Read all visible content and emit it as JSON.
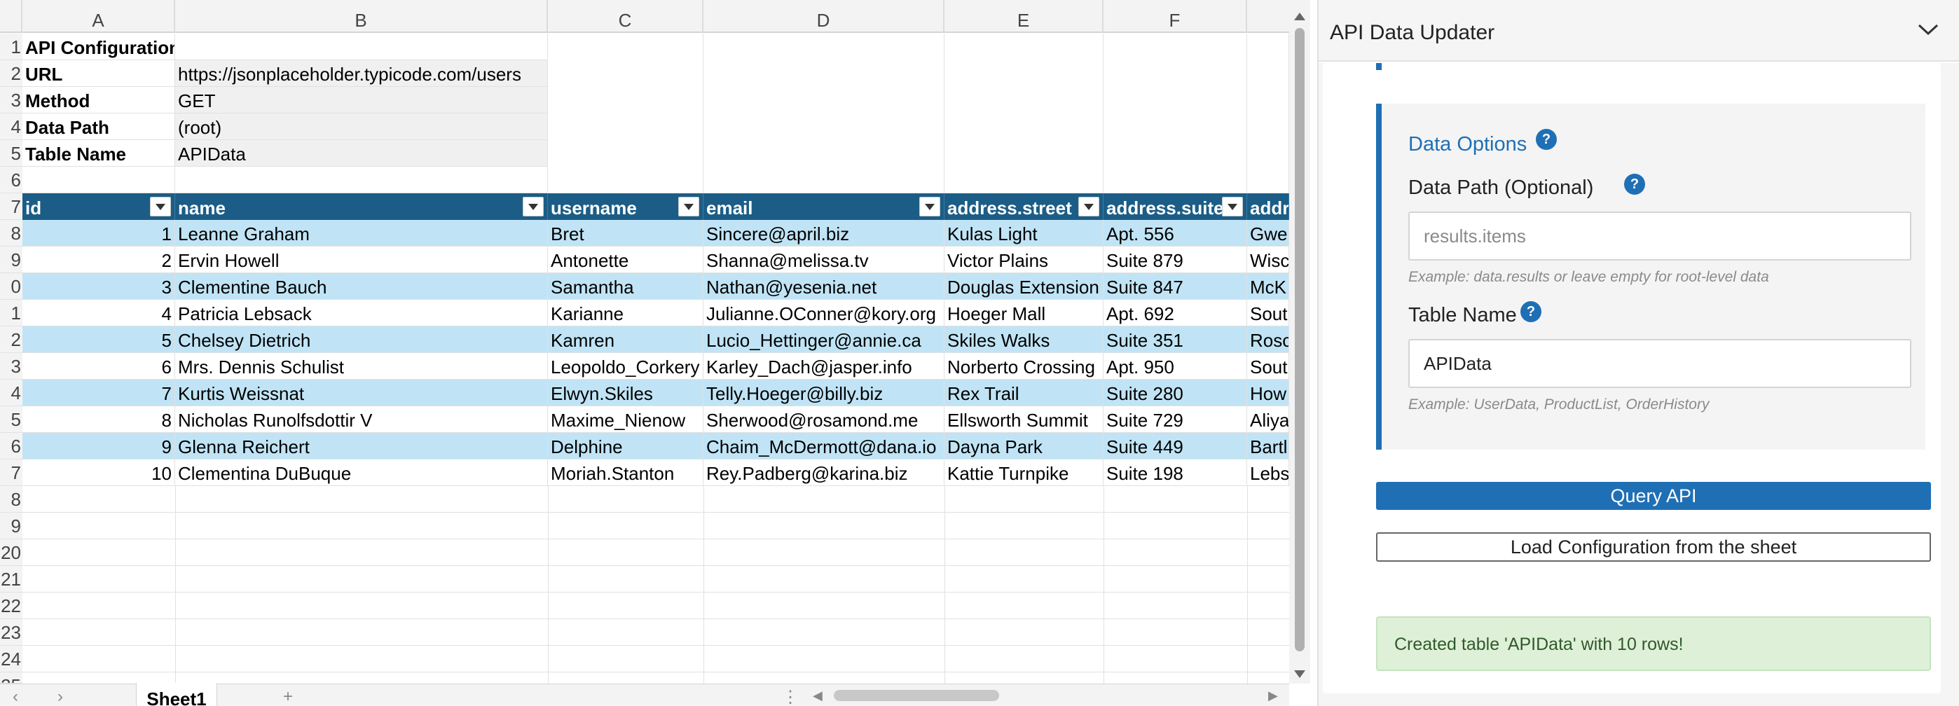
{
  "sheet": {
    "columns": [
      "A",
      "B",
      "C",
      "D",
      "E",
      "F"
    ],
    "rows": [
      "1",
      "2",
      "3",
      "4",
      "5",
      "6",
      "7",
      "8",
      "9",
      "0",
      "1",
      "2",
      "3",
      "4",
      "5",
      "6",
      "7",
      "8",
      "9",
      "20",
      "21",
      "22",
      "23",
      "24",
      "25"
    ],
    "config": [
      {
        "label": "API Configuration",
        "value": ""
      },
      {
        "label": "URL",
        "value": "https://jsonplaceholder.typicode.com/users"
      },
      {
        "label": "Method",
        "value": "GET"
      },
      {
        "label": "Data Path",
        "value": "(root)"
      },
      {
        "label": "Table Name",
        "value": "APIData"
      }
    ],
    "table_headers": [
      "id",
      "name",
      "username",
      "email",
      "address.street",
      "address.suite",
      "addr"
    ],
    "table_rows": [
      [
        "1",
        "Leanne Graham",
        "Bret",
        "Sincere@april.biz",
        "Kulas Light",
        "Apt. 556",
        "Gwe"
      ],
      [
        "2",
        "Ervin Howell",
        "Antonette",
        "Shanna@melissa.tv",
        "Victor Plains",
        "Suite 879",
        "Wisc"
      ],
      [
        "3",
        "Clementine Bauch",
        "Samantha",
        "Nathan@yesenia.net",
        "Douglas Extension",
        "Suite 847",
        "McK"
      ],
      [
        "4",
        "Patricia Lebsack",
        "Karianne",
        "Julianne.OConner@kory.org",
        "Hoeger Mall",
        "Apt. 692",
        "Sout"
      ],
      [
        "5",
        "Chelsey Dietrich",
        "Kamren",
        "Lucio_Hettinger@annie.ca",
        "Skiles Walks",
        "Suite 351",
        "Rosc"
      ],
      [
        "6",
        "Mrs. Dennis Schulist",
        "Leopoldo_Corkery",
        "Karley_Dach@jasper.info",
        "Norberto Crossing",
        "Apt. 950",
        "Sout"
      ],
      [
        "7",
        "Kurtis Weissnat",
        "Elwyn.Skiles",
        "Telly.Hoeger@billy.biz",
        "Rex Trail",
        "Suite 280",
        "How"
      ],
      [
        "8",
        "Nicholas Runolfsdottir V",
        "Maxime_Nienow",
        "Sherwood@rosamond.me",
        "Ellsworth Summit",
        "Suite 729",
        "Aliya"
      ],
      [
        "9",
        "Glenna Reichert",
        "Delphine",
        "Chaim_McDermott@dana.io",
        "Dayna Park",
        "Suite 449",
        "Bartl"
      ],
      [
        "10",
        "Clementina DuBuque",
        "Moriah.Stanton",
        "Rey.Padberg@karina.biz",
        "Kattie Turnpike",
        "Suite 198",
        "Lebs"
      ]
    ],
    "sheet_tab": "Sheet1"
  },
  "pane": {
    "title": "API Data Updater",
    "section_title": "Data Options",
    "help_glyph": "?",
    "data_path_label": "Data Path (Optional)",
    "data_path_placeholder": "results.items",
    "data_path_value": "",
    "data_path_hint": "Example: data.results or leave empty for root-level data",
    "table_name_label": "Table Name",
    "table_name_value": "APIData",
    "table_name_hint": "Example: UserData, ProductList, OrderHistory",
    "query_button": "Query API",
    "load_button": "Load Configuration from the sheet",
    "status_message": "Created table 'APIData' with 10 rows!"
  },
  "colors": {
    "accent": "#1f6fb5",
    "table_header": "#1b5d86",
    "table_band": "#c0e4f5",
    "success_bg": "#dff0d8"
  }
}
